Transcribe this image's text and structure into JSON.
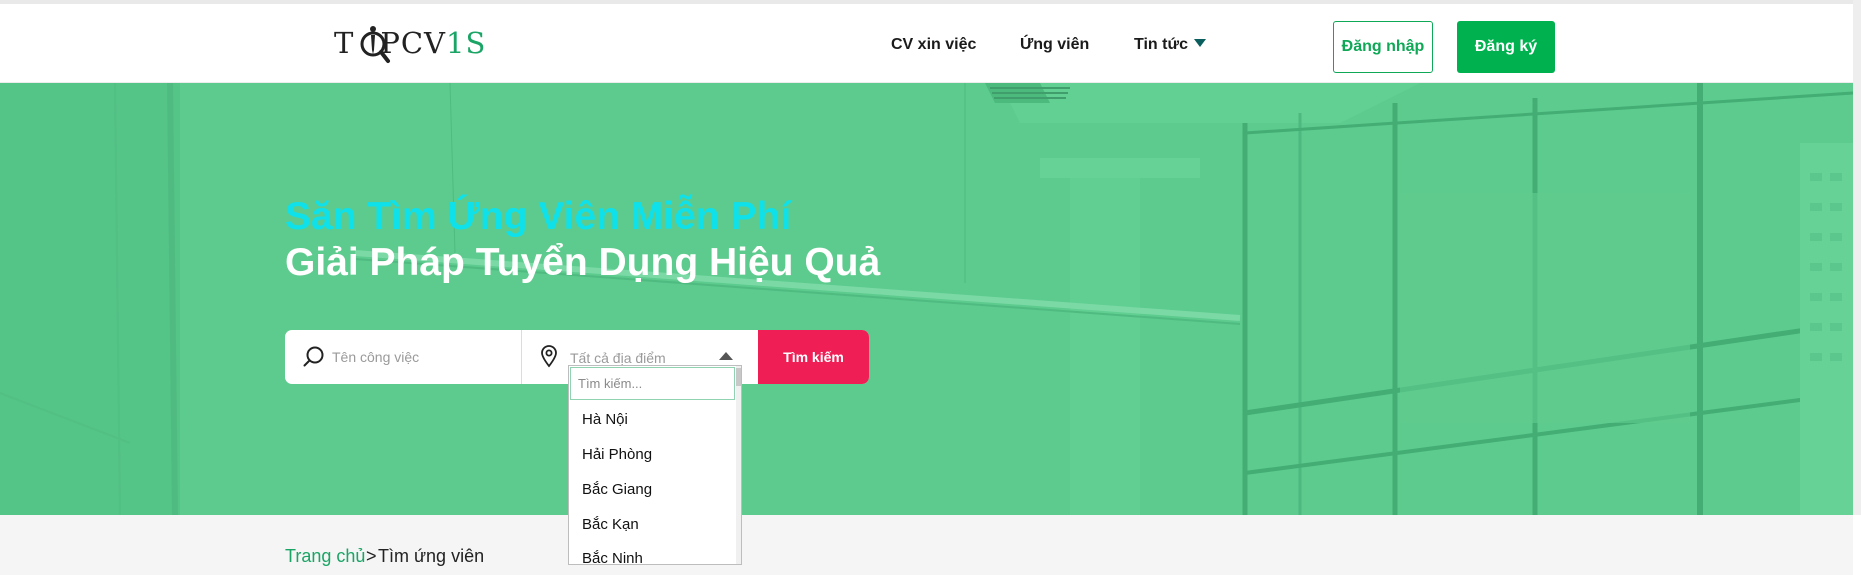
{
  "header": {
    "logo": {
      "part1": "T",
      "part2": "PCV",
      "part3": "1S"
    },
    "nav": [
      {
        "label": "CV xin việc"
      },
      {
        "label": "Ứng viên"
      },
      {
        "label": "Tin tức",
        "has_dropdown": true
      }
    ],
    "login_label": "Đăng nhập",
    "register_label": "Đăng ký"
  },
  "hero": {
    "title_line1": "Săn Tìm Ứng Viên Miễn Phí",
    "title_line2": "Giải Pháp Tuyển Dụng Hiệu Quả",
    "keyword_placeholder": "Tên công việc",
    "location_selected": "Tất cả địa điểm",
    "search_button": "Tìm kiếm"
  },
  "location_dropdown": {
    "search_placeholder": "Tìm kiếm...",
    "options": [
      "Hà Nội",
      "Hải Phòng",
      "Bắc Giang",
      "Bắc Kạn",
      "Bắc Ninh"
    ]
  },
  "breadcrumb": {
    "home": "Trang chủ",
    "separator": ">",
    "current": "Tìm ứng viên"
  },
  "colors": {
    "brand_green": "#00b14f",
    "hero_overlay": "#5ccb8d",
    "title_cyan": "#0ee1ea",
    "search_button": "#ef1f55"
  }
}
